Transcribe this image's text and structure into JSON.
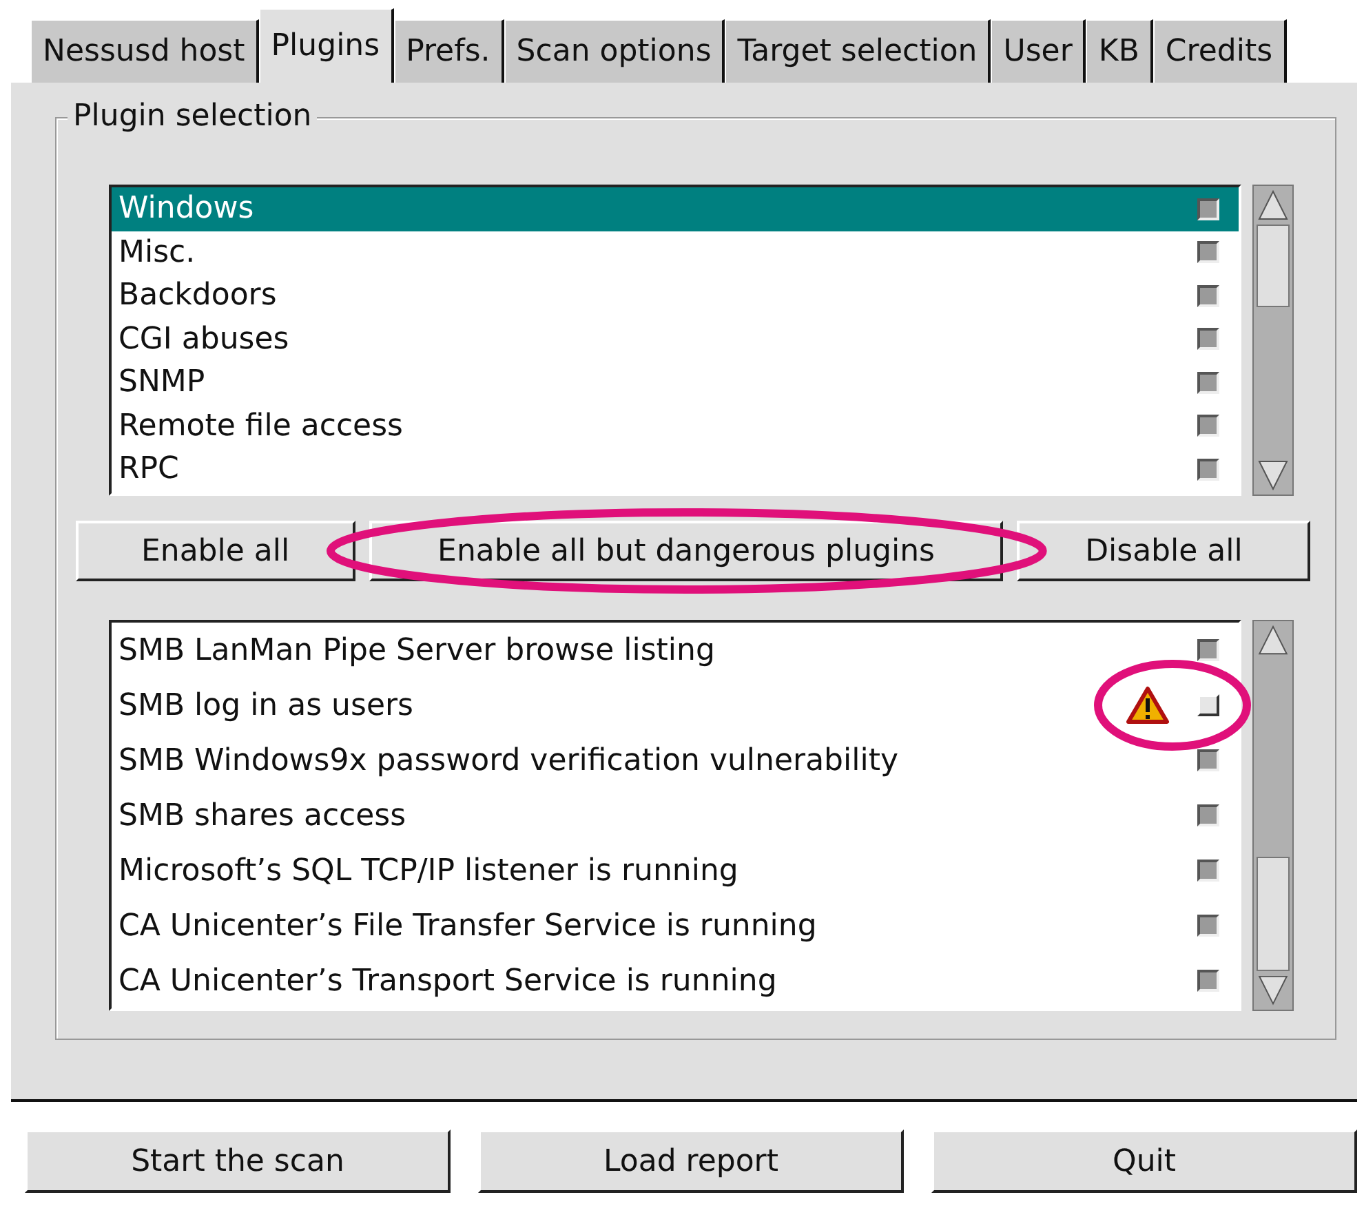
{
  "tabs": [
    {
      "label": "Nessusd host",
      "selected": false
    },
    {
      "label": "Plugins",
      "selected": true
    },
    {
      "label": "Prefs.",
      "selected": false
    },
    {
      "label": "Scan options",
      "selected": false
    },
    {
      "label": "Target selection",
      "selected": false
    },
    {
      "label": "User",
      "selected": false
    },
    {
      "label": "KB",
      "selected": false
    },
    {
      "label": "Credits",
      "selected": false
    }
  ],
  "plugin_selection": {
    "title": "Plugin selection",
    "families": [
      {
        "name": "Windows",
        "selected": true,
        "checked": true
      },
      {
        "name": "Misc.",
        "selected": false,
        "checked": true
      },
      {
        "name": "Backdoors",
        "selected": false,
        "checked": true
      },
      {
        "name": "CGI abuses",
        "selected": false,
        "checked": true
      },
      {
        "name": "SNMP",
        "selected": false,
        "checked": true
      },
      {
        "name": "Remote file access",
        "selected": false,
        "checked": true
      },
      {
        "name": "RPC",
        "selected": false,
        "checked": true
      }
    ],
    "buttons": [
      {
        "label": "Enable all",
        "highlighted": false
      },
      {
        "label": "Enable all but dangerous plugins",
        "highlighted": true
      },
      {
        "label": "Disable all",
        "highlighted": false
      }
    ],
    "plugins": [
      {
        "name": "SMB LanMan Pipe Server browse listing",
        "dangerous": false,
        "checked": true,
        "highlighted": false
      },
      {
        "name": "SMB log in as users",
        "dangerous": true,
        "checked": false,
        "highlighted": true
      },
      {
        "name": "SMB Windows9x password verification vulnerability",
        "dangerous": false,
        "checked": true,
        "highlighted": false
      },
      {
        "name": "SMB shares access",
        "dangerous": false,
        "checked": true,
        "highlighted": false
      },
      {
        "name": "Microsoft’s SQL TCP/IP listener is running",
        "dangerous": false,
        "checked": true,
        "highlighted": false
      },
      {
        "name": "CA Unicenter’s File Transfer Service is running",
        "dangerous": false,
        "checked": true,
        "highlighted": false
      },
      {
        "name": "CA Unicenter’s Transport Service is running",
        "dangerous": false,
        "checked": true,
        "highlighted": false
      }
    ]
  },
  "bottom_buttons": [
    "Start the scan",
    "Load report",
    "Quit"
  ]
}
